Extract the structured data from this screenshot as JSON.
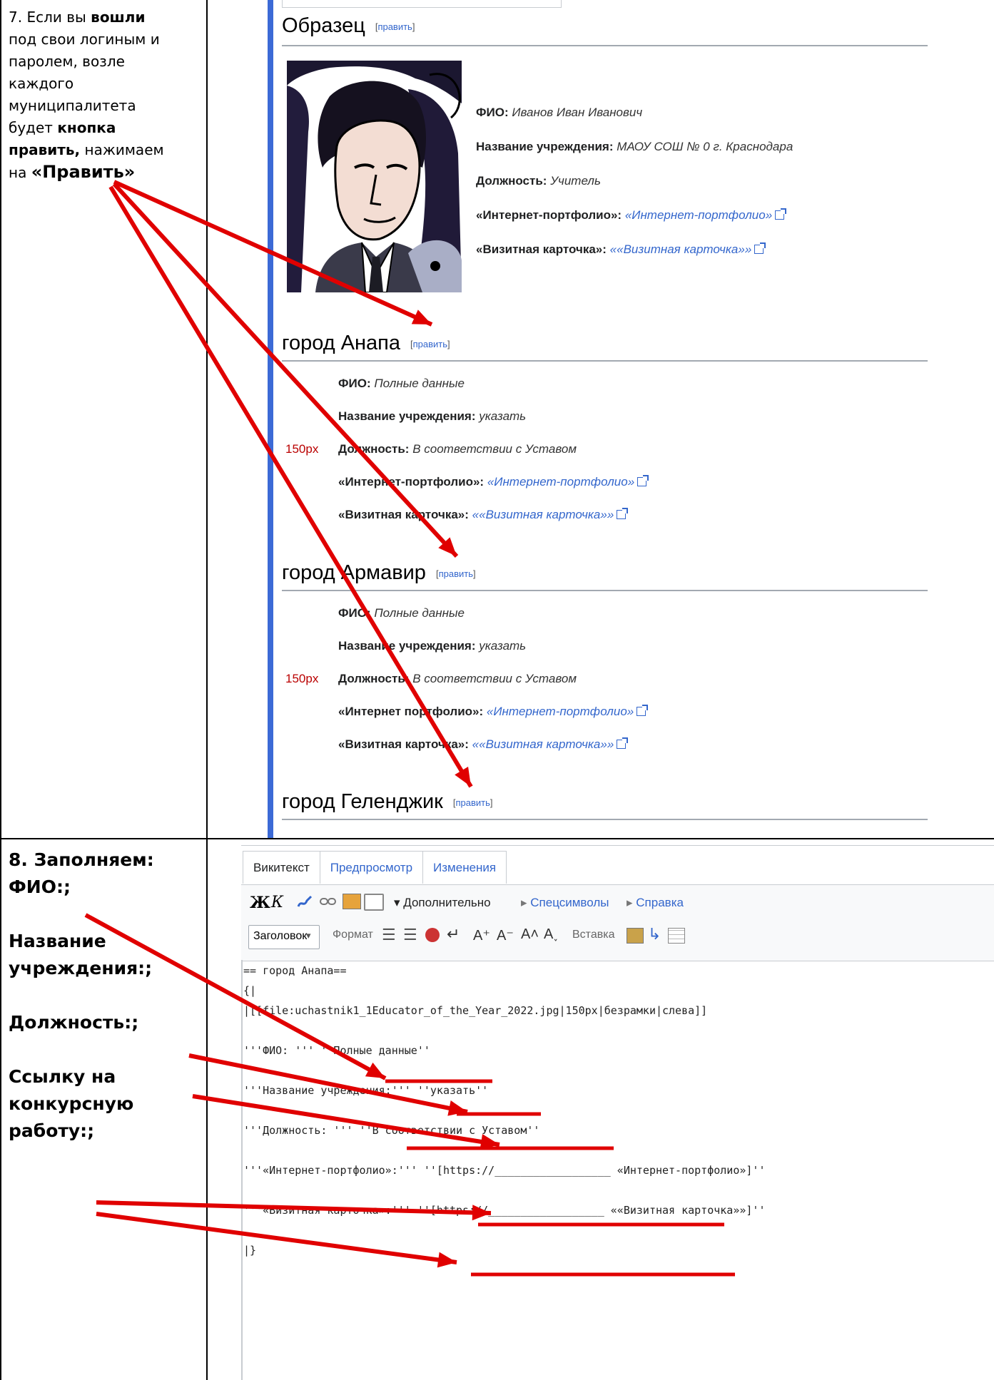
{
  "step7": {
    "lines": [
      {
        "parts": [
          {
            "t": "7. Если вы "
          },
          {
            "t": "вошли",
            "b": true
          }
        ]
      },
      {
        "parts": [
          {
            "t": "под свои логиным и"
          }
        ]
      },
      {
        "parts": [
          {
            "t": "паролем, возле"
          }
        ]
      },
      {
        "parts": [
          {
            "t": "каждого"
          }
        ]
      },
      {
        "parts": [
          {
            "t": "муниципалитета"
          }
        ]
      },
      {
        "parts": [
          {
            "t": "будет "
          },
          {
            "t": "кнопка",
            "b": true
          }
        ]
      },
      {
        "parts": [
          {
            "t": "править,",
            "b": true
          },
          {
            "t": " нажимаем"
          }
        ]
      },
      {
        "parts": [
          {
            "t": "на "
          },
          {
            "t": "«Править»",
            "b": true,
            "big": true
          }
        ]
      }
    ]
  },
  "wiki": {
    "sample": {
      "heading": "Образец",
      "edit": "править",
      "fields": [
        {
          "label": "ФИО:",
          "value": "Иванов Иван Иванович",
          "link": false
        },
        {
          "label": "Название учреждения:",
          "value": "МАОУ СОШ № 0 г. Краснодара",
          "link": false
        },
        {
          "label": "Должность:",
          "value": "Учитель",
          "link": false
        },
        {
          "label": "«Интернет-портфолио»:",
          "value": "«Интернет-портфолио»",
          "link": true
        },
        {
          "label": "«Визитная карточка»:",
          "value": "««Визитная карточка»»",
          "link": true
        }
      ]
    },
    "cities": [
      {
        "heading": "город Анапа",
        "edit": "править",
        "px": "150px",
        "fields": [
          {
            "label": "ФИО:",
            "value": "Полные данные",
            "link": false
          },
          {
            "label": "Название учреждения:",
            "value": "указать",
            "link": false
          },
          {
            "label": "Должность:",
            "value": "В соответствии с Уставом",
            "link": false
          },
          {
            "label": "«Интернет-портфолио»:",
            "value": "«Интернет-портфолио»",
            "link": true
          },
          {
            "label": "«Визитная карточка»:",
            "value": "««Визитная карточка»»",
            "link": true
          }
        ]
      },
      {
        "heading": "город Армавир",
        "edit": "править",
        "px": "150px",
        "fields": [
          {
            "label": "ФИО:",
            "value": "Полные данные",
            "link": false
          },
          {
            "label": "Название учреждения:",
            "value": "указать",
            "link": false
          },
          {
            "label": "Должность:",
            "value": "В соответствии с Уставом",
            "link": false
          },
          {
            "label": "«Интернет портфолио»:",
            "value": "«Интернет-портфолио»",
            "link": true
          },
          {
            "label": "«Визитная карточка»:",
            "value": "««Визитная карточка»»",
            "link": true
          }
        ]
      },
      {
        "heading": "город Геленджик",
        "edit": "править"
      }
    ]
  },
  "step8": {
    "lines": [
      "8. Заполняем:",
      "ФИО:;",
      "",
      "Название",
      "учреждения:;",
      "",
      "Должность:;",
      "",
      "Ссылку на",
      "конкурсную",
      "работу:;"
    ]
  },
  "editor": {
    "tabs": [
      "Викитекст",
      "Предпросмотр",
      "Изменения"
    ],
    "toolbar1": {
      "bold": "Ж",
      "italic": "К",
      "more": "Дополнительно",
      "special": "Спецсимволы",
      "help": "Справка"
    },
    "toolbar2": {
      "heading": "Заголовок",
      "format": "Формат",
      "insert": "Вставка"
    },
    "code": [
      "== город Анапа==",
      "{|",
      "|[[file:uchastnik1_1Educator_of_the_Year_2022.jpg|150px|безрамки|слева]]",
      "",
      "'''ФИО: ''' ''Полные данные''",
      "",
      "'''Название учреждения:''' ''указать''",
      "",
      "'''Должность: ''' ''В соответствии с Уставом''",
      "",
      "'''«Интернет-портфолио»:''' ''[https://__________________ «Интернет-портфолио»]''",
      "",
      "'''«Визитная карточка»:''' ''[https://__________________ ««Визитная карточка»»]''",
      "",
      "|}"
    ]
  },
  "colors": {
    "arrow": "#e00000",
    "bar": "#3c6ad6",
    "link": "#3366cc"
  }
}
